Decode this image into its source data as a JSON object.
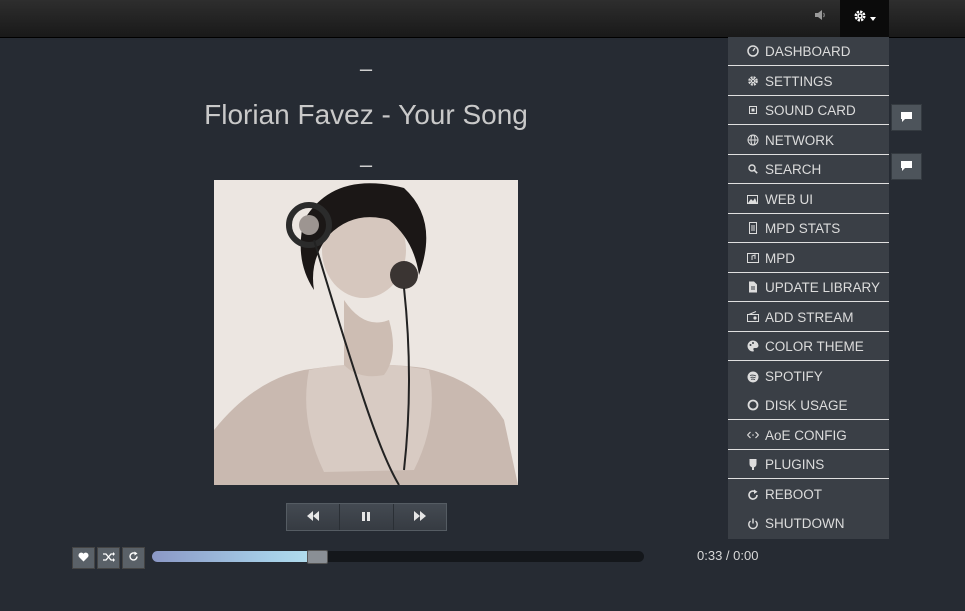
{
  "topbar": {
    "volume_icon": "volume-icon",
    "settings_icon": "gear-icon"
  },
  "now_playing": {
    "line_above": "–",
    "title": "Florian Favez - Your Song",
    "line_below": "–"
  },
  "transport": {
    "prev_icon": "previous-icon",
    "pause_icon": "pause-icon",
    "next_icon": "next-icon"
  },
  "controls": {
    "favorite_icon": "heart-icon",
    "shuffle_icon": "shuffle-icon",
    "repeat_icon": "repeat-icon"
  },
  "playback": {
    "progress_fraction": 0.35,
    "time_text": "0:33 / 0:00"
  },
  "menu": {
    "items": [
      {
        "label": "DASHBOARD",
        "icon": "dashboard-icon"
      },
      {
        "label": "SETTINGS",
        "icon": "gear-icon"
      },
      {
        "label": "SOUND CARD",
        "icon": "chip-icon"
      },
      {
        "label": "NETWORK",
        "icon": "globe-icon"
      },
      {
        "label": "SEARCH",
        "icon": "search-icon"
      },
      {
        "label": "WEB UI",
        "icon": "images-icon"
      },
      {
        "label": "MPD STATS",
        "icon": "file-icon"
      },
      {
        "label": "MPD",
        "icon": "music-file-icon"
      },
      {
        "label": "UPDATE LIBRARY",
        "icon": "document-icon"
      },
      {
        "label": "ADD STREAM",
        "icon": "radio-icon"
      },
      {
        "label": "COLOR THEME",
        "icon": "palette-icon"
      },
      {
        "label": "SPOTIFY",
        "icon": "spotify-icon"
      },
      {
        "label": "DISK USAGE",
        "icon": "circle-icon"
      },
      {
        "label": "AoE CONFIG",
        "icon": "arrows-icon"
      },
      {
        "label": "PLUGINS",
        "icon": "plug-icon"
      },
      {
        "label": "REBOOT",
        "icon": "refresh-icon"
      },
      {
        "label": "SHUTDOWN",
        "icon": "power-icon"
      }
    ]
  },
  "colors": {
    "background": "#262b33",
    "menu_bg": "#3a3f46",
    "progress_fill": "#a6cfe8"
  }
}
